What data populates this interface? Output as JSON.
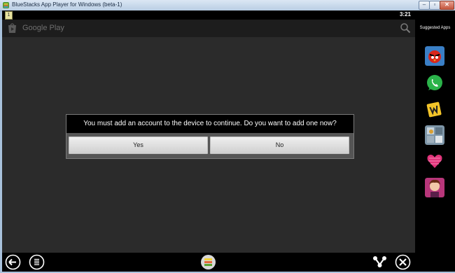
{
  "window": {
    "title": "BlueStacks App Player for Windows (beta-1)",
    "minimize_glyph": "–",
    "restore_glyph": "▫",
    "close_glyph": "✕"
  },
  "statusbar": {
    "notification_badge": "1",
    "clock": "3:21"
  },
  "actionbar": {
    "title": "Google Play"
  },
  "dialog": {
    "message": "You must add an account to the device to continue. Do you want to add one now?",
    "yes_label": "Yes",
    "no_label": "No"
  },
  "sidebar": {
    "header": "Suggested Apps",
    "apps": [
      "angry-birds-icon",
      "whatsapp-icon",
      "words-icon",
      "app-icon",
      "heart-icon",
      "game-girl-icon"
    ]
  },
  "colors": {
    "screen_bg": "#2b2b2b",
    "dialog_bg": "#000000",
    "whatsapp": "#2bb34a",
    "bluestacks": "#5aa32e"
  }
}
